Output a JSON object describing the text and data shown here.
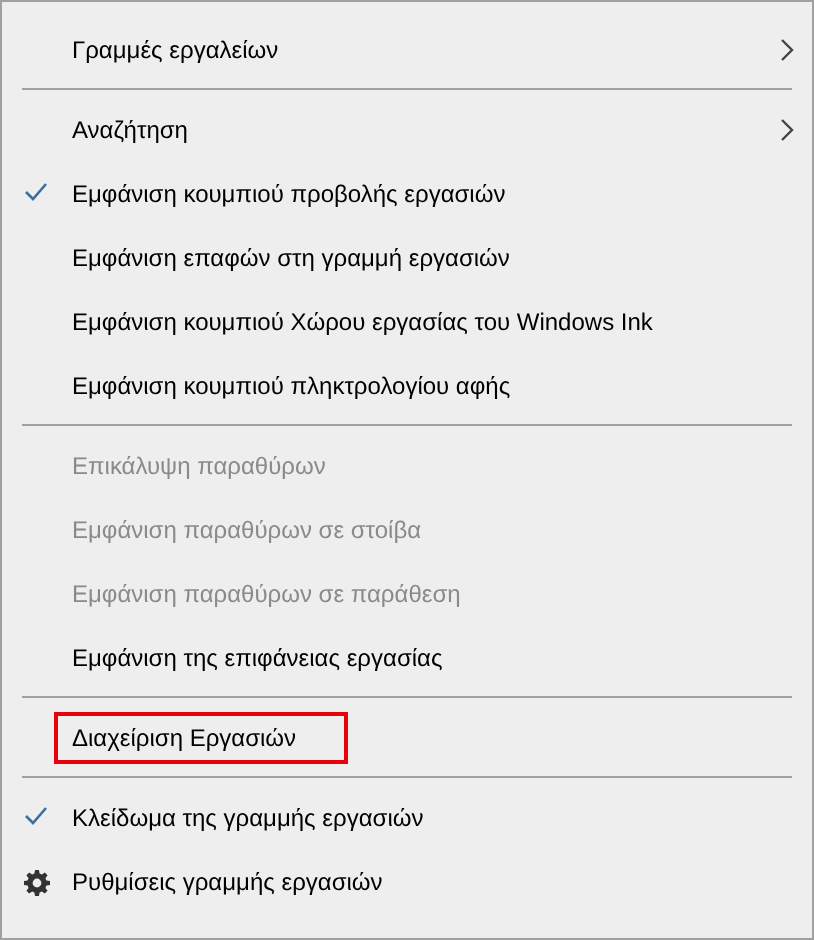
{
  "menu": {
    "groups": [
      {
        "items": [
          {
            "label": "Γραμμές εργαλείων",
            "kind": "submenu",
            "disabled": false,
            "highlighted": false
          }
        ]
      },
      {
        "items": [
          {
            "label": "Αναζήτηση",
            "kind": "submenu",
            "disabled": false,
            "highlighted": false
          },
          {
            "label": "Εμφάνιση κουμπιού προβολής εργασιών",
            "kind": "check",
            "checked": true,
            "disabled": false,
            "highlighted": false
          },
          {
            "label": "Εμφάνιση επαφών στη γραμμή εργασιών",
            "kind": "check",
            "checked": false,
            "disabled": false,
            "highlighted": false
          },
          {
            "label": "Εμφάνιση κουμπιού Χώρου εργασίας του Windows Ink",
            "kind": "check",
            "checked": false,
            "disabled": false,
            "highlighted": false
          },
          {
            "label": "Εμφάνιση κουμπιού πληκτρολογίου αφής",
            "kind": "check",
            "checked": false,
            "disabled": false,
            "highlighted": false
          }
        ]
      },
      {
        "items": [
          {
            "label": "Επικάλυψη παραθύρων",
            "kind": "plain",
            "disabled": true,
            "highlighted": false
          },
          {
            "label": "Εμφάνιση παραθύρων σε στοίβα",
            "kind": "plain",
            "disabled": true,
            "highlighted": false
          },
          {
            "label": "Εμφάνιση παραθύρων σε παράθεση",
            "kind": "plain",
            "disabled": true,
            "highlighted": false
          },
          {
            "label": "Εμφάνιση της επιφάνειας εργασίας",
            "kind": "plain",
            "disabled": false,
            "highlighted": false
          }
        ]
      },
      {
        "items": [
          {
            "label": "Διαχείριση Εργασιών",
            "kind": "plain",
            "disabled": false,
            "highlighted": true
          }
        ]
      },
      {
        "items": [
          {
            "label": "Κλείδωμα της γραμμής εργασιών",
            "kind": "check",
            "checked": true,
            "disabled": false,
            "highlighted": false
          },
          {
            "label": "Ρυθμίσεις γραμμής εργασιών",
            "kind": "settings",
            "disabled": false,
            "highlighted": false
          }
        ]
      }
    ]
  }
}
